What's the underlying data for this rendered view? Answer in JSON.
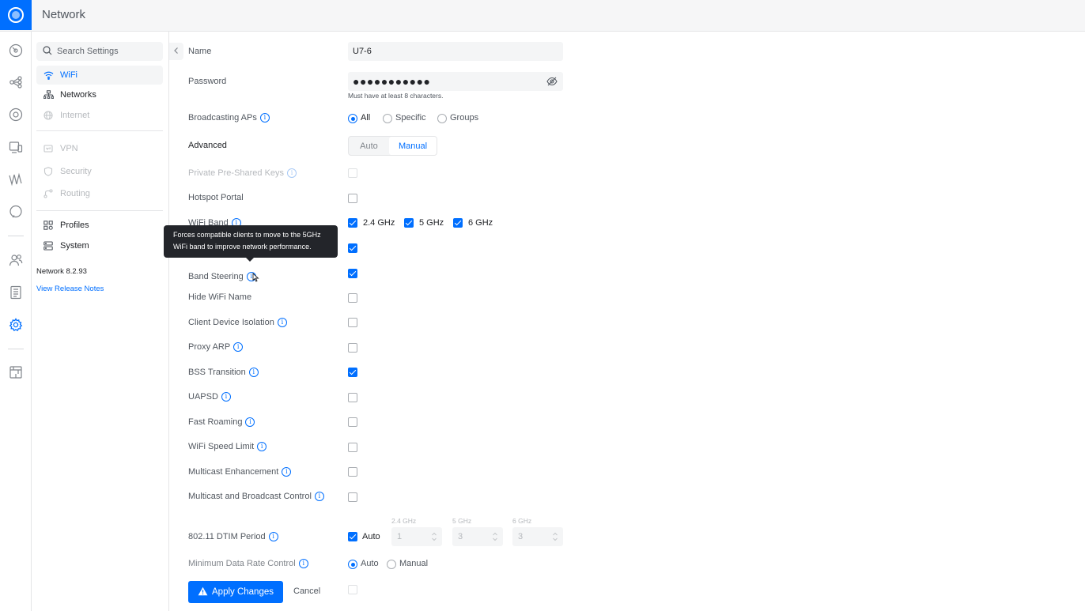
{
  "app": {
    "title": "Network"
  },
  "sidebar": {
    "search_placeholder": "Search Settings",
    "items": [
      {
        "label": "WiFi",
        "icon": "wifi-icon",
        "state": "active"
      },
      {
        "label": "Networks",
        "icon": "networks-icon",
        "state": "normal"
      },
      {
        "label": "Internet",
        "icon": "internet-icon",
        "state": "disabled"
      },
      {
        "label": "VPN",
        "icon": "vpn-icon",
        "state": "disabled"
      },
      {
        "label": "Security",
        "icon": "shield-icon",
        "state": "disabled"
      },
      {
        "label": "Routing",
        "icon": "routing-icon",
        "state": "disabled"
      },
      {
        "label": "Profiles",
        "icon": "profiles-icon",
        "state": "normal"
      },
      {
        "label": "System",
        "icon": "system-icon",
        "state": "normal"
      }
    ],
    "version": "Network 8.2.93",
    "release_notes": "View Release Notes"
  },
  "form": {
    "name_label": "Name",
    "name_value": "U7-6",
    "password_label": "Password",
    "password_mask": "●●●●●●●●●●●",
    "password_hint": "Must have at least 8 characters.",
    "broadcasting_label": "Broadcasting APs",
    "broadcasting_options": [
      "All",
      "Specific",
      "Groups"
    ],
    "broadcasting_selected": "All",
    "advanced_label": "Advanced",
    "advanced_options": [
      "Auto",
      "Manual"
    ],
    "advanced_selected": "Manual",
    "ppsk_label": "Private Pre-Shared Keys",
    "hotspot_label": "Hotspot Portal",
    "wifi_band_label": "WiFi Band",
    "bands": [
      "2.4 GHz",
      "5 GHz",
      "6 GHz"
    ],
    "tooltip_line1": "Forces compatible clients to move to the 5GHz",
    "tooltip_line2": "WiFi band to improve network performance.",
    "band_steering_label": "Band Steering",
    "hide_wifi_label": "Hide WiFi Name",
    "client_isolation_label": "Client Device Isolation",
    "proxy_arp_label": "Proxy ARP",
    "bss_label": "BSS Transition",
    "uapsd_label": "UAPSD",
    "fast_roaming_label": "Fast Roaming",
    "speed_limit_label": "WiFi Speed Limit",
    "multicast_enh_label": "Multicast Enhancement",
    "multicast_ctrl_label": "Multicast and Broadcast Control",
    "dtim_label": "802.11 DTIM Period",
    "dtim_auto_label": "Auto",
    "dtim_headers": [
      "2.4 GHz",
      "5 GHz",
      "6 GHz"
    ],
    "dtim_values": [
      "1",
      "3",
      "3"
    ],
    "min_rate_label": "Minimum Data Rate Control",
    "min_rate_options": [
      "Auto",
      "Manual"
    ],
    "min_rate_selected": "Auto",
    "apply_label": "Apply Changes",
    "cancel_label": "Cancel"
  },
  "colors": {
    "accent": "#006fff",
    "tooltip_bg": "#23252a"
  }
}
